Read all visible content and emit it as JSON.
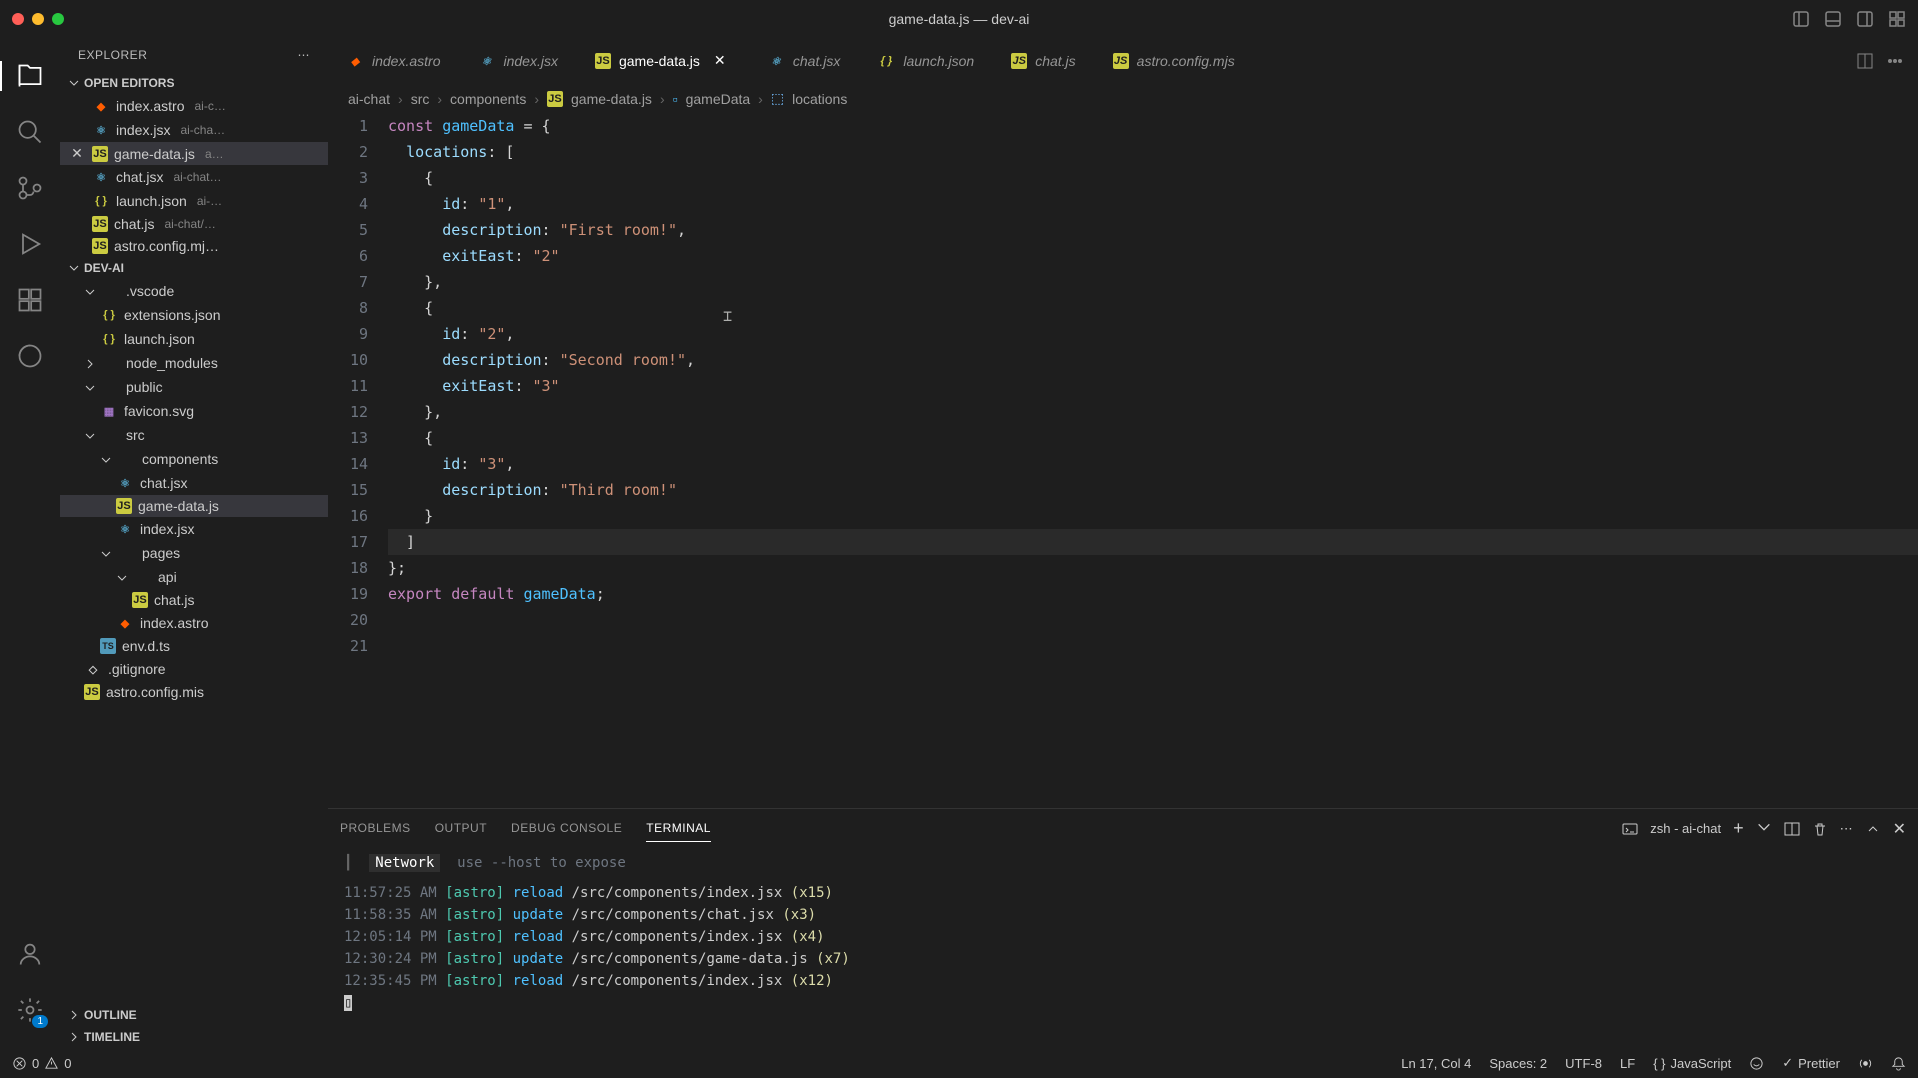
{
  "window": {
    "title": "game-data.js — dev-ai"
  },
  "sidebar": {
    "title": "EXPLORER",
    "openEditorsLabel": "OPEN EDITORS",
    "projectLabel": "DEV-AI",
    "outlineLabel": "OUTLINE",
    "timelineLabel": "TIMELINE",
    "openEditors": [
      {
        "name": "index.astro",
        "path": "ai-c…",
        "icon": "astro"
      },
      {
        "name": "index.jsx",
        "path": "ai-cha…",
        "icon": "jsx"
      },
      {
        "name": "game-data.js",
        "path": "a…",
        "icon": "js",
        "active": true
      },
      {
        "name": "chat.jsx",
        "path": "ai-chat…",
        "icon": "jsx"
      },
      {
        "name": "launch.json",
        "path": "ai-…",
        "icon": "json"
      },
      {
        "name": "chat.js",
        "path": "ai-chat/…",
        "icon": "js"
      },
      {
        "name": "astro.config.mj…",
        "path": "",
        "icon": "js"
      }
    ],
    "tree": [
      {
        "name": ".vscode",
        "indent": 1,
        "type": "folder",
        "open": true
      },
      {
        "name": "extensions.json",
        "indent": 2,
        "type": "json"
      },
      {
        "name": "launch.json",
        "indent": 2,
        "type": "json"
      },
      {
        "name": "node_modules",
        "indent": 1,
        "type": "folder",
        "open": false
      },
      {
        "name": "public",
        "indent": 1,
        "type": "folder",
        "open": true
      },
      {
        "name": "favicon.svg",
        "indent": 2,
        "type": "svg"
      },
      {
        "name": "src",
        "indent": 1,
        "type": "folder",
        "open": true
      },
      {
        "name": "components",
        "indent": 2,
        "type": "folder",
        "open": true
      },
      {
        "name": "chat.jsx",
        "indent": 3,
        "type": "jsx"
      },
      {
        "name": "game-data.js",
        "indent": 3,
        "type": "js",
        "active": true
      },
      {
        "name": "index.jsx",
        "indent": 3,
        "type": "jsx"
      },
      {
        "name": "pages",
        "indent": 2,
        "type": "folder",
        "open": true
      },
      {
        "name": "api",
        "indent": 3,
        "type": "folder",
        "open": true
      },
      {
        "name": "chat.js",
        "indent": 4,
        "type": "js"
      },
      {
        "name": "index.astro",
        "indent": 3,
        "type": "astro"
      },
      {
        "name": "env.d.ts",
        "indent": 2,
        "type": "ts"
      },
      {
        "name": ".gitignore",
        "indent": 1,
        "type": "file"
      },
      {
        "name": "astro.config.mis",
        "indent": 1,
        "type": "js"
      }
    ]
  },
  "tabs": [
    {
      "name": "index.astro",
      "icon": "astro"
    },
    {
      "name": "index.jsx",
      "icon": "jsx"
    },
    {
      "name": "game-data.js",
      "icon": "js",
      "active": true,
      "close": true
    },
    {
      "name": "chat.jsx",
      "icon": "jsx"
    },
    {
      "name": "launch.json",
      "icon": "json"
    },
    {
      "name": "chat.js",
      "icon": "js"
    },
    {
      "name": "astro.config.mjs",
      "icon": "js"
    }
  ],
  "breadcrumb": {
    "parts": [
      "ai-chat",
      "src",
      "components",
      "game-data.js",
      "gameData",
      "locations"
    ]
  },
  "code": {
    "lines": [
      {
        "n": 1,
        "tokens": [
          [
            "kw",
            "const"
          ],
          [
            "punc",
            " "
          ],
          [
            "var",
            "gameData"
          ],
          [
            "punc",
            " = {"
          ]
        ]
      },
      {
        "n": 2,
        "tokens": [
          [
            "punc",
            "  "
          ],
          [
            "prop",
            "locations"
          ],
          [
            "punc",
            ": ["
          ]
        ]
      },
      {
        "n": 3,
        "tokens": [
          [
            "punc",
            "    {"
          ]
        ]
      },
      {
        "n": 4,
        "tokens": [
          [
            "punc",
            "      "
          ],
          [
            "prop",
            "id"
          ],
          [
            "punc",
            ": "
          ],
          [
            "str",
            "\"1\""
          ],
          [
            "punc",
            ","
          ]
        ]
      },
      {
        "n": 5,
        "tokens": [
          [
            "punc",
            "      "
          ],
          [
            "prop",
            "description"
          ],
          [
            "punc",
            ": "
          ],
          [
            "str",
            "\"First room!\""
          ],
          [
            "punc",
            ","
          ]
        ]
      },
      {
        "n": 6,
        "tokens": [
          [
            "punc",
            "      "
          ],
          [
            "prop",
            "exitEast"
          ],
          [
            "punc",
            ": "
          ],
          [
            "str",
            "\"2\""
          ]
        ]
      },
      {
        "n": 7,
        "tokens": [
          [
            "punc",
            "    },"
          ]
        ]
      },
      {
        "n": 8,
        "tokens": [
          [
            "punc",
            "    {"
          ]
        ]
      },
      {
        "n": 9,
        "tokens": [
          [
            "punc",
            "      "
          ],
          [
            "prop",
            "id"
          ],
          [
            "punc",
            ": "
          ],
          [
            "str",
            "\"2\""
          ],
          [
            "punc",
            ","
          ]
        ]
      },
      {
        "n": 10,
        "tokens": [
          [
            "punc",
            "      "
          ],
          [
            "prop",
            "description"
          ],
          [
            "punc",
            ": "
          ],
          [
            "str",
            "\"Second room!\""
          ],
          [
            "punc",
            ","
          ]
        ]
      },
      {
        "n": 11,
        "tokens": [
          [
            "punc",
            "      "
          ],
          [
            "prop",
            "exitEast"
          ],
          [
            "punc",
            ": "
          ],
          [
            "str",
            "\"3\""
          ]
        ]
      },
      {
        "n": 12,
        "tokens": [
          [
            "punc",
            "    },"
          ]
        ]
      },
      {
        "n": 13,
        "tokens": [
          [
            "punc",
            "    {"
          ]
        ]
      },
      {
        "n": 14,
        "tokens": [
          [
            "punc",
            "      "
          ],
          [
            "prop",
            "id"
          ],
          [
            "punc",
            ": "
          ],
          [
            "str",
            "\"3\""
          ],
          [
            "punc",
            ","
          ]
        ]
      },
      {
        "n": 15,
        "tokens": [
          [
            "punc",
            "      "
          ],
          [
            "prop",
            "description"
          ],
          [
            "punc",
            ": "
          ],
          [
            "str",
            "\"Third room!\""
          ]
        ]
      },
      {
        "n": 16,
        "tokens": [
          [
            "punc",
            "    }"
          ]
        ]
      },
      {
        "n": 17,
        "tokens": [
          [
            "punc",
            "  ]"
          ]
        ],
        "current": true
      },
      {
        "n": 18,
        "tokens": [
          [
            "punc",
            "};"
          ]
        ]
      },
      {
        "n": 19,
        "tokens": [
          [
            "punc",
            ""
          ]
        ]
      },
      {
        "n": 20,
        "tokens": [
          [
            "kw",
            "export"
          ],
          [
            "punc",
            " "
          ],
          [
            "kw",
            "default"
          ],
          [
            "punc",
            " "
          ],
          [
            "var",
            "gameData"
          ],
          [
            "punc",
            ";"
          ]
        ]
      },
      {
        "n": 21,
        "tokens": [
          [
            "punc",
            ""
          ]
        ]
      }
    ]
  },
  "panel": {
    "tabs": [
      "PROBLEMS",
      "OUTPUT",
      "DEBUG CONSOLE",
      "TERMINAL"
    ],
    "activeTab": "TERMINAL",
    "terminalLabel": "zsh - ai-chat",
    "networkLabel": "Network",
    "networkHint": "use --host to expose",
    "lines": [
      {
        "time": "11:57:25 AM",
        "tag": "[astro]",
        "action": "reload",
        "path": "/src/components/index.jsx",
        "count": "(x15)"
      },
      {
        "time": "11:58:35 AM",
        "tag": "[astro]",
        "action": "update",
        "path": "/src/components/chat.jsx",
        "count": "(x3)"
      },
      {
        "time": "12:05:14 PM",
        "tag": "[astro]",
        "action": "reload",
        "path": "/src/components/index.jsx",
        "count": "(x4)"
      },
      {
        "time": "12:30:24 PM",
        "tag": "[astro]",
        "action": "update",
        "path": "/src/components/game-data.js",
        "count": "(x7)"
      },
      {
        "time": "12:35:45 PM",
        "tag": "[astro]",
        "action": "reload",
        "path": "/src/components/index.jsx",
        "count": "(x12)"
      }
    ]
  },
  "status": {
    "errors": "0",
    "warnings": "0",
    "cursor": "Ln 17, Col 4",
    "spaces": "Spaces: 2",
    "encoding": "UTF-8",
    "eol": "LF",
    "lang": "JavaScript",
    "prettier": "Prettier"
  },
  "activity": {
    "gearBadge": "1"
  }
}
